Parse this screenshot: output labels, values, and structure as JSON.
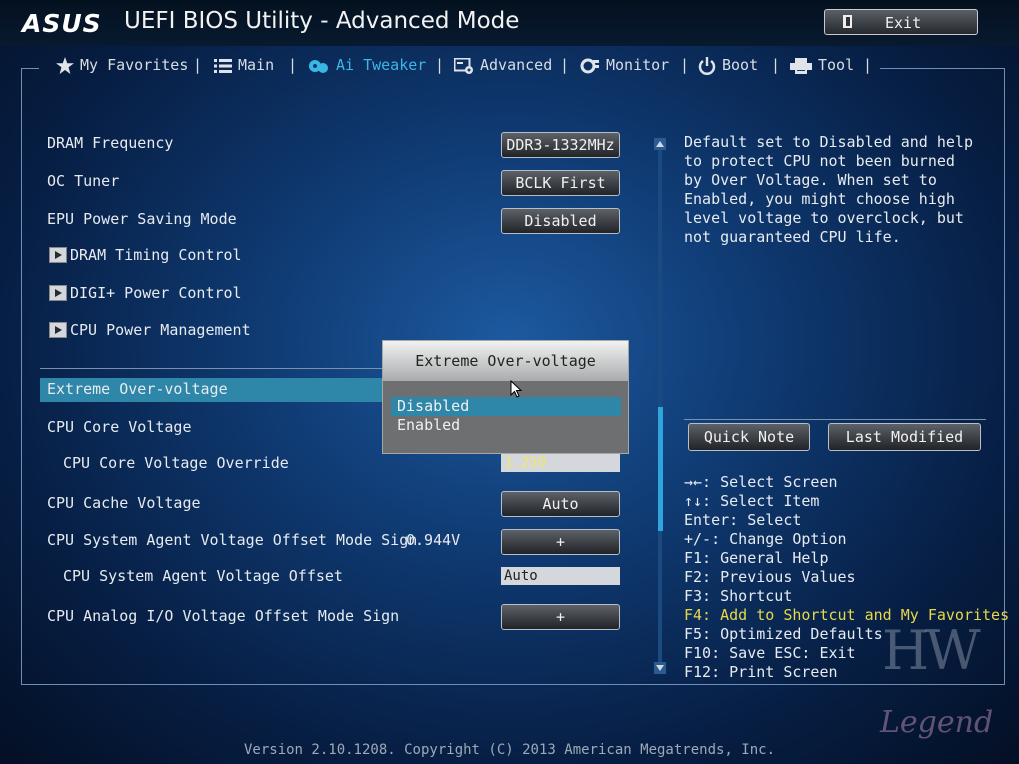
{
  "header": {
    "logo": "ASUS",
    "title": "UEFI BIOS Utility - Advanced Mode",
    "exit_label": "Exit"
  },
  "tabs": [
    {
      "label": "My Favorites",
      "icon": "star-icon"
    },
    {
      "label": "Main",
      "icon": "list-icon"
    },
    {
      "label": "Ai Tweaker",
      "icon": "tweaker-icon",
      "active": true
    },
    {
      "label": "Advanced",
      "icon": "advanced-icon"
    },
    {
      "label": "Monitor",
      "icon": "monitor-icon"
    },
    {
      "label": "Boot",
      "icon": "power-icon"
    },
    {
      "label": "Tool",
      "icon": "printer-icon"
    }
  ],
  "settings": {
    "dram_frequency": {
      "label": "DRAM Frequency",
      "value": "DDR3-1332MHz"
    },
    "oc_tuner": {
      "label": "OC Tuner",
      "value": "BCLK First"
    },
    "epu": {
      "label": "EPU Power Saving Mode",
      "value": "Disabled"
    },
    "dram_timing": {
      "label": "DRAM Timing Control"
    },
    "digi_power": {
      "label": "DIGI+ Power Control"
    },
    "cpu_power_mgmt": {
      "label": "CPU Power Management"
    },
    "extreme_ov": {
      "label": "Extreme Over-voltage"
    },
    "cpu_core_voltage": {
      "label": "CPU Core Voltage"
    },
    "cpu_core_voltage_override": {
      "label": "CPU Core Voltage Override",
      "value": "1.250"
    },
    "cpu_cache_voltage": {
      "label": "CPU Cache Voltage",
      "value": "Auto"
    },
    "sa_offset_sign": {
      "label": "CPU System Agent Voltage Offset Mode Sign",
      "reading": "0.944V",
      "value": "+"
    },
    "sa_offset": {
      "label": "CPU System Agent Voltage Offset",
      "value": "Auto"
    },
    "analog_io_sign": {
      "label": "CPU Analog I/O Voltage Offset Mode Sign",
      "value": "+"
    }
  },
  "popup": {
    "title": "Extreme Over-voltage",
    "options": [
      "Disabled",
      "Enabled"
    ],
    "selected": "Disabled"
  },
  "help_text": "Default set to Disabled and help to protect CPU not been burned by Over Voltage. When set to Enabled, you might choose high level voltage to overclock, but not guaranteed CPU life.",
  "right_buttons": {
    "quick_note": "Quick Note",
    "last_modified": "Last Modified"
  },
  "keys": [
    "→←: Select Screen",
    "↑↓: Select Item",
    "Enter: Select",
    "+/-: Change Option",
    "F1: General Help",
    "F2: Previous Values",
    "F3: Shortcut",
    "F4: Add to Shortcut and My Favorites",
    "F5: Optimized Defaults",
    "F10: Save  ESC: Exit",
    "F12: Print Screen"
  ],
  "footer": "Version 2.10.1208. Copyright (C) 2013 American Megatrends, Inc.",
  "watermark": {
    "line1": "HW",
    "line2": "Legend"
  },
  "colors": {
    "accent": "#3bb7e6",
    "selection": "#2e86a8",
    "highlight_key": "#e7d84a"
  }
}
